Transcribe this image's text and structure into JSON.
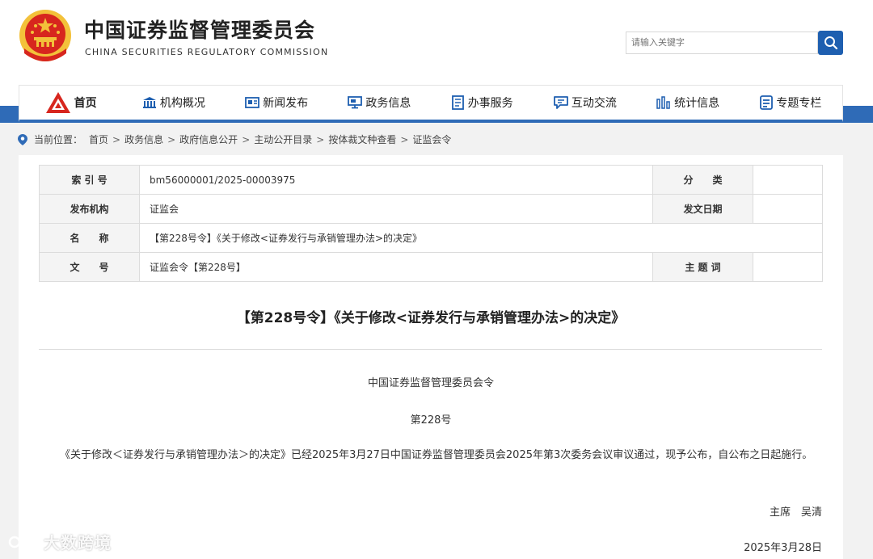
{
  "header": {
    "title_cn": "中国证券监督管理委员会",
    "title_en": "CHINA SECURITIES REGULATORY COMMISSION",
    "search_placeholder": "请输入关键字"
  },
  "colors": {
    "brand_blue": "#2f6bb7",
    "emblem_red": "#d7261e",
    "emblem_gold": "#f3c13a"
  },
  "nav": [
    {
      "label": "首页",
      "icon": "home-logo-icon"
    },
    {
      "label": "机构概况",
      "icon": "building-icon"
    },
    {
      "label": "新闻发布",
      "icon": "newspaper-icon"
    },
    {
      "label": "政务信息",
      "icon": "monitor-icon"
    },
    {
      "label": "办事服务",
      "icon": "document-list-icon"
    },
    {
      "label": "互动交流",
      "icon": "chat-icon"
    },
    {
      "label": "统计信息",
      "icon": "bar-chart-icon"
    },
    {
      "label": "专题专栏",
      "icon": "document-icon"
    }
  ],
  "breadcrumb": {
    "prefix": "当前位置：",
    "items": [
      "首页",
      "政务信息",
      "政府信息公开",
      "主动公开目录",
      "按体裁文种查看",
      "证监会令"
    ],
    "sep": ">"
  },
  "meta": {
    "index_label": "索 引 号",
    "index_value": "bm56000001/2025-00003975",
    "category_label": "分　　类",
    "category_value": "",
    "publisher_label": "发布机构",
    "publisher_value": "证监会",
    "date_label": "发文日期",
    "date_value": "",
    "name_label": "名　　称",
    "name_value": "【第228号令】《关于修改<证券发行与承销管理办法>的决定》",
    "docno_label": "文　　号",
    "docno_value": "证监会令【第228号】",
    "keywords_label": "主 题 词",
    "keywords_value": ""
  },
  "document": {
    "title": "【第228号令】《关于修改<证券发行与承销管理办法>的决定》",
    "issuer_line": "中国证券监督管理委员会令",
    "number_line": "第228号",
    "body": "《关于修改＜证券发行与承销管理办法＞的决定》已经2025年3月27日中国证券监督管理委员会2025年第3次委务会议审议通过，现予公布，自公布之日起施行。",
    "signature": "主席　吴清",
    "date": "2025年3月28日"
  },
  "watermark": {
    "text": "大数跨境"
  }
}
